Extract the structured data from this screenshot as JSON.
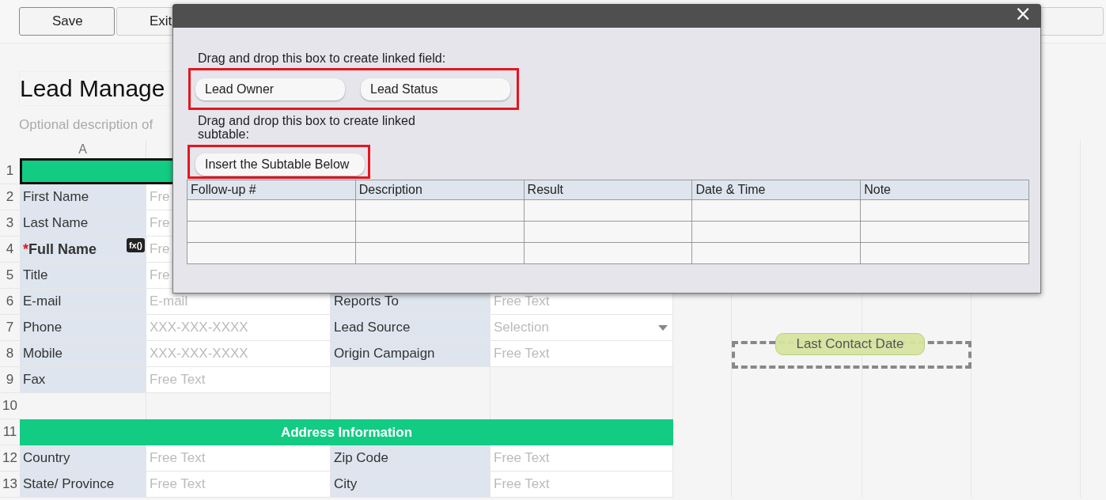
{
  "toolbar": {
    "buttons": [
      {
        "kind": "plain",
        "label": "Save"
      },
      {
        "kind": "plain",
        "label": "Exit"
      }
    ]
  },
  "form": {
    "title": "Lead Manage",
    "description": "Optional description of",
    "column_header": "A"
  },
  "rows": [
    {
      "number": "1",
      "cells": [
        {
          "kind": "section",
          "selected": true
        }
      ]
    },
    {
      "number": "2",
      "cells": [
        {
          "kind": "label",
          "text": "First Name"
        },
        {
          "kind": "input",
          "text": "Fre"
        }
      ]
    },
    {
      "number": "3",
      "cells": [
        {
          "kind": "label",
          "text": "Last Name"
        },
        {
          "kind": "input",
          "text": "Fre"
        }
      ]
    },
    {
      "number": "4",
      "cells": [
        {
          "kind": "label",
          "text": "Full Name",
          "required_mark": "*",
          "bold": true,
          "badge": "fx()"
        },
        {
          "kind": "input",
          "text": "Fre"
        }
      ]
    },
    {
      "number": "5",
      "cells": [
        {
          "kind": "label",
          "text": "Title"
        },
        {
          "kind": "input",
          "text": "Fre"
        }
      ]
    },
    {
      "number": "6",
      "cells": [
        {
          "kind": "label",
          "text": "E-mail"
        },
        {
          "kind": "input",
          "text": "E-mail"
        },
        {
          "kind": "label",
          "text": "Reports To"
        },
        {
          "kind": "input",
          "text": "Free Text"
        }
      ]
    },
    {
      "number": "7",
      "cells": [
        {
          "kind": "label",
          "text": "Phone"
        },
        {
          "kind": "input",
          "text": "XXX-XXX-XXXX"
        },
        {
          "kind": "label",
          "text": "Lead Source"
        },
        {
          "kind": "input",
          "text": "Selection",
          "dropdown": true
        }
      ]
    },
    {
      "number": "8",
      "cells": [
        {
          "kind": "label",
          "text": "Mobile"
        },
        {
          "kind": "input",
          "text": "XXX-XXX-XXXX"
        },
        {
          "kind": "label",
          "text": "Origin Campaign"
        },
        {
          "kind": "input",
          "text": "Free Text"
        }
      ]
    },
    {
      "number": "9",
      "cells": [
        {
          "kind": "label",
          "text": "Fax"
        },
        {
          "kind": "input",
          "text": "Free Text"
        }
      ]
    },
    {
      "number": "10",
      "cells": []
    },
    {
      "number": "11",
      "cells": [
        {
          "kind": "section",
          "text": "Address Information",
          "selected": false
        }
      ]
    },
    {
      "number": "12",
      "cells": [
        {
          "kind": "label",
          "text": "Country"
        },
        {
          "kind": "input",
          "text": "Free Text"
        },
        {
          "kind": "label",
          "text": "Zip Code"
        },
        {
          "kind": "input",
          "text": "Free Text"
        }
      ]
    },
    {
      "number": "13",
      "cells": [
        {
          "kind": "label",
          "text": "State/ Province"
        },
        {
          "kind": "input",
          "text": "Free Text"
        },
        {
          "kind": "label",
          "text": "City"
        },
        {
          "kind": "input",
          "text": "Free Text"
        }
      ]
    }
  ],
  "dragging_field": {
    "label": "Last Contact Date"
  },
  "dialog": {
    "close": "×",
    "linked_field": {
      "hint": "Drag and drop this box to create linked field:",
      "highlighted": true,
      "chips": [
        {
          "label": "Lead Owner"
        },
        {
          "label": "Lead Status"
        }
      ]
    },
    "linked_subtable": {
      "hint": "Drag and drop this box to create linked subtable:",
      "highlighted": true,
      "chips": [
        {
          "label": "Insert the Subtable Below"
        }
      ]
    },
    "subtable": {
      "columns": [
        "Follow-up #",
        "Description",
        "Result",
        "Date & Time",
        "Note"
      ]
    }
  }
}
